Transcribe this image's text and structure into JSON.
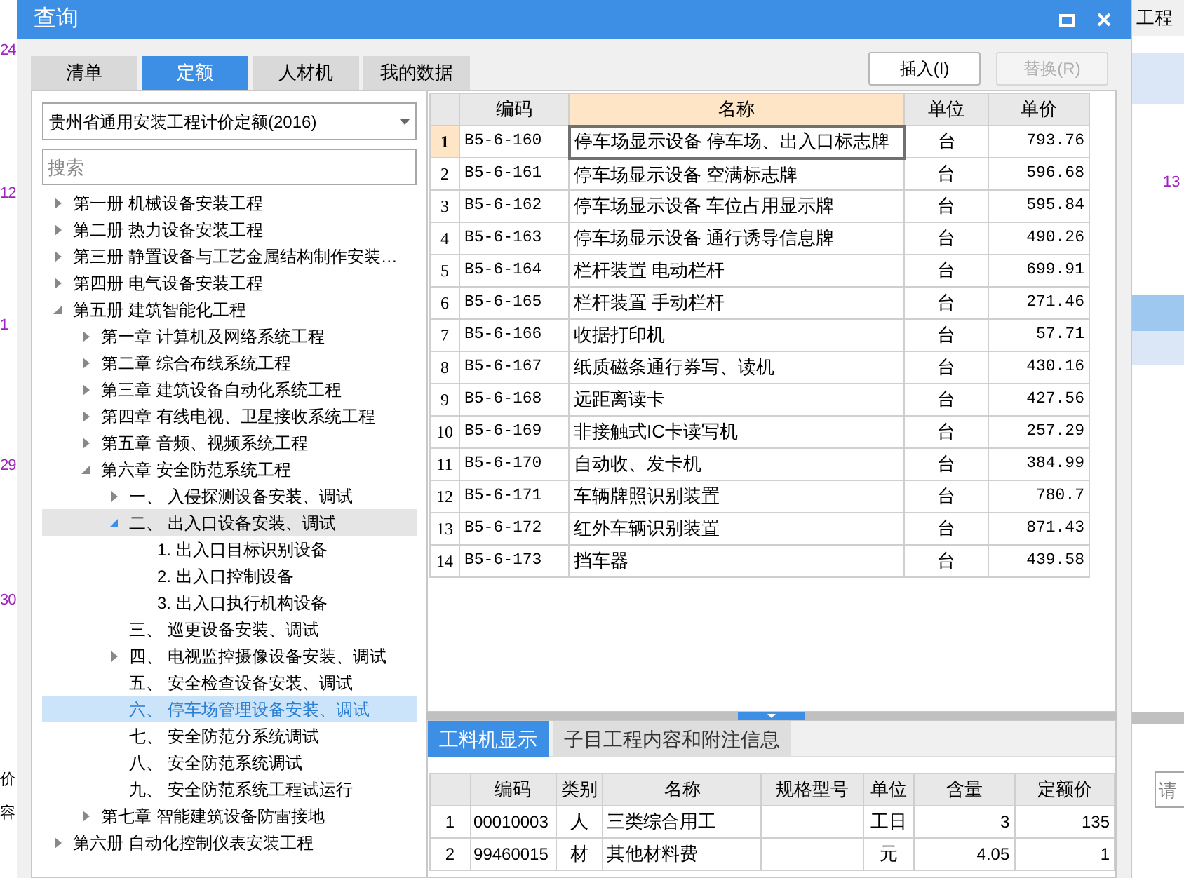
{
  "background_app": {
    "left_cells": [
      "24",
      "12",
      "1",
      "29",
      "30",
      "价",
      "容"
    ],
    "right_header": "工程",
    "right_cells": [
      "13"
    ],
    "right_field": {
      "placeholder": "请"
    }
  },
  "window": {
    "title": "查询"
  },
  "tabs": [
    {
      "label": "清单",
      "selected": false
    },
    {
      "label": "定额",
      "selected": true
    },
    {
      "label": "人材机",
      "selected": false
    },
    {
      "label": "我的数据",
      "selected": false
    }
  ],
  "buttons": [
    {
      "label": "插入(I)",
      "disabled": false
    },
    {
      "label": "替换(R)",
      "disabled": true
    }
  ],
  "quota_dropdown": {
    "value": "贵州省通用安装工程计价定额(2016)"
  },
  "search": {
    "placeholder": "搜索"
  },
  "tree": [
    {
      "label": "第一册 机械设备安装工程",
      "kind": "branch",
      "expanded": false,
      "selected": false,
      "hovered": false
    },
    {
      "label": "第二册 热力设备安装工程",
      "kind": "branch",
      "expanded": false,
      "selected": false,
      "hovered": false
    },
    {
      "label": "第三册 静置设备与工艺金属结构制作安装…",
      "kind": "branch",
      "expanded": false,
      "selected": false,
      "hovered": false
    },
    {
      "label": "第四册 电气设备安装工程",
      "kind": "branch",
      "expanded": false,
      "selected": false,
      "hovered": false
    },
    {
      "label": "第五册 建筑智能化工程",
      "kind": "branch",
      "expanded": true,
      "selected": false,
      "hovered": false,
      "children": [
        {
          "label": "第一章 计算机及网络系统工程",
          "kind": "branch",
          "expanded": false,
          "selected": false,
          "hovered": false
        },
        {
          "label": "第二章 综合布线系统工程",
          "kind": "branch",
          "expanded": false,
          "selected": false,
          "hovered": false
        },
        {
          "label": "第三章 建筑设备自动化系统工程",
          "kind": "branch",
          "expanded": false,
          "selected": false,
          "hovered": false
        },
        {
          "label": "第四章 有线电视、卫星接收系统工程",
          "kind": "branch",
          "expanded": false,
          "selected": false,
          "hovered": false
        },
        {
          "label": "第五章 音频、视频系统工程",
          "kind": "branch",
          "expanded": false,
          "selected": false,
          "hovered": false
        },
        {
          "label": "第六章 安全防范系统工程",
          "kind": "branch",
          "expanded": true,
          "selected": false,
          "hovered": false,
          "children": [
            {
              "label": "一、 入侵探测设备安装、调试",
              "kind": "branch",
              "expanded": false,
              "selected": false,
              "hovered": false
            },
            {
              "label": "二、 出入口设备安装、调试",
              "kind": "branch",
              "expanded": true,
              "selected": false,
              "hovered": true,
              "children": [
                {
                  "label": "1. 出入口目标识别设备",
                  "kind": "leaf",
                  "selected": false,
                  "hovered": false
                },
                {
                  "label": "2. 出入口控制设备",
                  "kind": "leaf",
                  "selected": false,
                  "hovered": false
                },
                {
                  "label": "3. 出入口执行机构设备",
                  "kind": "leaf",
                  "selected": false,
                  "hovered": false
                }
              ]
            },
            {
              "label": "三、 巡更设备安装、调试",
              "kind": "leaf",
              "selected": false,
              "hovered": false
            },
            {
              "label": "四、 电视监控摄像设备安装、调试",
              "kind": "branch",
              "expanded": false,
              "selected": false,
              "hovered": false
            },
            {
              "label": "五、 安全检查设备安装、调试",
              "kind": "leaf",
              "selected": false,
              "hovered": false
            },
            {
              "label": "六、 停车场管理设备安装、调试",
              "kind": "leaf",
              "selected": true,
              "hovered": false
            },
            {
              "label": "七、 安全防范分系统调试",
              "kind": "leaf",
              "selected": false,
              "hovered": false
            },
            {
              "label": "八、 安全防范系统调试",
              "kind": "leaf",
              "selected": false,
              "hovered": false
            },
            {
              "label": "九、 安全防范系统工程试运行",
              "kind": "leaf",
              "selected": false,
              "hovered": false
            }
          ]
        },
        {
          "label": "第七章 智能建筑设备防雷接地",
          "kind": "branch",
          "expanded": false,
          "selected": false,
          "hovered": false
        }
      ]
    },
    {
      "label": "第六册 自动化控制仪表安装工程",
      "kind": "branch",
      "expanded": false,
      "selected": false,
      "hovered": false
    }
  ],
  "quota_table": {
    "columns": [
      {
        "label": "编码",
        "selected": false
      },
      {
        "label": "名称",
        "selected": true
      },
      {
        "label": "单位",
        "selected": false
      },
      {
        "label": "单价",
        "selected": false
      }
    ],
    "rows": [
      {
        "index": "1",
        "code": "B5-6-160",
        "name": "停车场显示设备 停车场、出入口标志牌",
        "unit": "台",
        "price": "793.76",
        "selected": true
      },
      {
        "index": "2",
        "code": "B5-6-161",
        "name": "停车场显示设备 空满标志牌",
        "unit": "台",
        "price": "596.68",
        "selected": false
      },
      {
        "index": "3",
        "code": "B5-6-162",
        "name": "停车场显示设备 车位占用显示牌",
        "unit": "台",
        "price": "595.84",
        "selected": false
      },
      {
        "index": "4",
        "code": "B5-6-163",
        "name": "停车场显示设备 通行诱导信息牌",
        "unit": "台",
        "price": "490.26",
        "selected": false
      },
      {
        "index": "5",
        "code": "B5-6-164",
        "name": "栏杆装置 电动栏杆",
        "unit": "台",
        "price": "699.91",
        "selected": false
      },
      {
        "index": "6",
        "code": "B5-6-165",
        "name": "栏杆装置 手动栏杆",
        "unit": "台",
        "price": "271.46",
        "selected": false
      },
      {
        "index": "7",
        "code": "B5-6-166",
        "name": "收据打印机",
        "unit": "台",
        "price": "57.71",
        "selected": false
      },
      {
        "index": "8",
        "code": "B5-6-167",
        "name": "纸质磁条通行券写、读机",
        "unit": "台",
        "price": "430.16",
        "selected": false
      },
      {
        "index": "9",
        "code": "B5-6-168",
        "name": "远距离读卡",
        "unit": "台",
        "price": "427.56",
        "selected": false
      },
      {
        "index": "10",
        "code": "B5-6-169",
        "name": "非接触式IC卡读写机",
        "unit": "台",
        "price": "257.29",
        "selected": false
      },
      {
        "index": "11",
        "code": "B5-6-170",
        "name": "自动收、发卡机",
        "unit": "台",
        "price": "384.99",
        "selected": false
      },
      {
        "index": "12",
        "code": "B5-6-171",
        "name": "车辆牌照识别装置",
        "unit": "台",
        "price": "780.7",
        "selected": false
      },
      {
        "index": "13",
        "code": "B5-6-172",
        "name": "红外车辆识别装置",
        "unit": "台",
        "price": "871.43",
        "selected": false
      },
      {
        "index": "14",
        "code": "B5-6-173",
        "name": "挡车器",
        "unit": "台",
        "price": "439.58",
        "selected": false
      }
    ]
  },
  "detail_tabs": [
    {
      "label": "工料机显示",
      "selected": true
    },
    {
      "label": "子目工程内容和附注信息",
      "selected": false
    }
  ],
  "resource_table": {
    "columns": [
      "编码",
      "类别",
      "名称",
      "规格型号",
      "单位",
      "含量",
      "定额价"
    ],
    "rows": [
      {
        "index": "1",
        "code": "00010003",
        "category": "人",
        "name": "三类综合用工",
        "unit": "工日",
        "amount": "3",
        "price": "135"
      },
      {
        "index": "2",
        "code": "99460015",
        "category": "材",
        "name": "其他材料费",
        "unit": "元",
        "amount": "4.05",
        "price": "1"
      }
    ]
  }
}
